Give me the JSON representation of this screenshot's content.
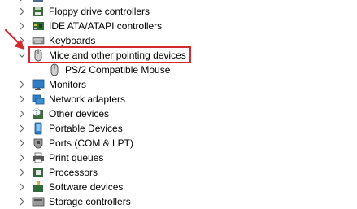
{
  "tree": {
    "items": [
      {
        "label": "Floppy drive controllers",
        "icon": "floppy-controller-icon",
        "expanded": false
      },
      {
        "label": "IDE ATA/ATAPI controllers",
        "icon": "ide-controller-icon",
        "expanded": false
      },
      {
        "label": "Keyboards",
        "icon": "keyboard-icon",
        "expanded": false
      },
      {
        "label": "Mice and other pointing devices",
        "icon": "mouse-icon",
        "expanded": true
      },
      {
        "label": "PS/2 Compatible Mouse",
        "icon": "mouse-icon",
        "child": true
      },
      {
        "label": "Monitors",
        "icon": "monitor-icon",
        "expanded": false
      },
      {
        "label": "Network adapters",
        "icon": "network-adapter-icon",
        "expanded": false
      },
      {
        "label": "Other devices",
        "icon": "unknown-device-icon",
        "expanded": false
      },
      {
        "label": "Portable Devices",
        "icon": "portable-device-icon",
        "expanded": false
      },
      {
        "label": "Ports (COM & LPT)",
        "icon": "port-icon",
        "expanded": false
      },
      {
        "label": "Print queues",
        "icon": "printer-icon",
        "expanded": false
      },
      {
        "label": "Processors",
        "icon": "processor-icon",
        "expanded": false
      },
      {
        "label": "Software devices",
        "icon": "software-device-icon",
        "expanded": false
      },
      {
        "label": "Storage controllers",
        "icon": "storage-controller-icon",
        "expanded": false
      }
    ]
  },
  "highlight": {
    "color": "#d8282d"
  },
  "colors": {
    "chevron": "#6b6b6b"
  }
}
